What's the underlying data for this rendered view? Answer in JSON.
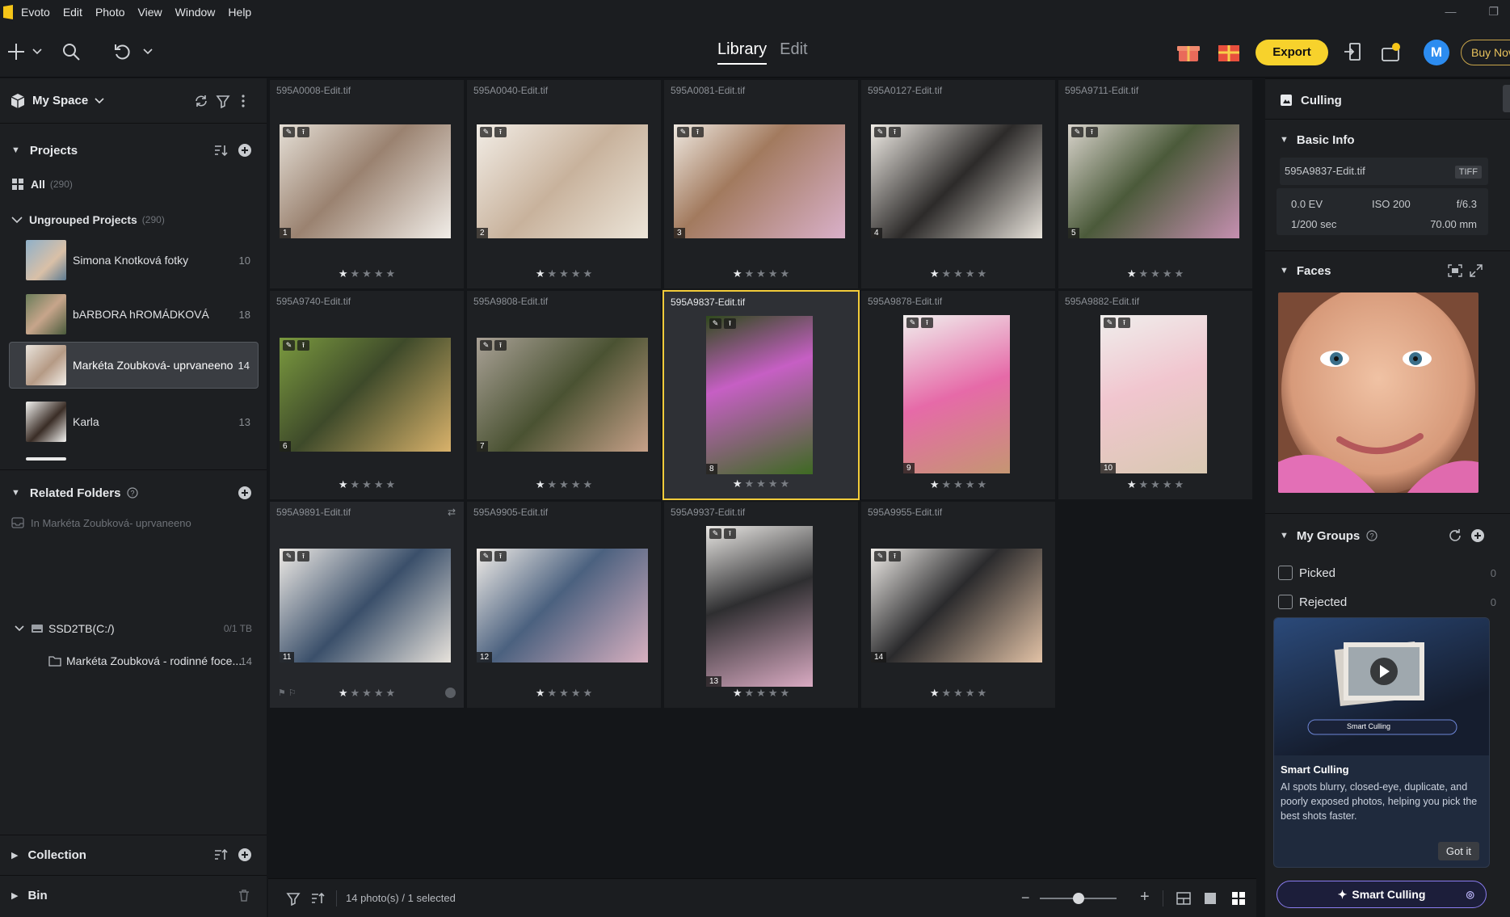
{
  "menubar": {
    "app_name": "Evoto",
    "items": [
      "Edit",
      "Photo",
      "View",
      "Window",
      "Help"
    ]
  },
  "toolbar": {
    "tab_library": "Library",
    "tab_edit": "Edit",
    "export_label": "Export",
    "avatar_initial": "M",
    "buy_label": "Buy Nov"
  },
  "left_panel": {
    "space_title": "My Space",
    "projects_title": "Projects",
    "all_label": "All",
    "all_count": "(290)",
    "ungrouped_label": "Ungrouped Projects",
    "ungrouped_count": "(290)",
    "projects": [
      {
        "name": "Simona Knotková fotky",
        "count": "10"
      },
      {
        "name": "bARBORA hROMÁDKOVÁ",
        "count": "18"
      },
      {
        "name": "Markéta Zoubková- uprvaneeno",
        "count": "14"
      },
      {
        "name": "Karla",
        "count": "13"
      }
    ],
    "related_folders_title": "Related Folders",
    "in_project_label": "In Markéta Zoubková- uprvaneeno",
    "drive_label": "SSD2TB(C:/)",
    "drive_count": "0/1 TB",
    "folder_label": "Markéta Zoubková - rodinné foce...",
    "folder_count": "14",
    "collection_title": "Collection",
    "bin_title": "Bin"
  },
  "grid": {
    "photos": [
      {
        "name": "595A0008-Edit.tif",
        "num": "1"
      },
      {
        "name": "595A0040-Edit.tif",
        "num": "2"
      },
      {
        "name": "595A0081-Edit.tif",
        "num": "3"
      },
      {
        "name": "595A0127-Edit.tif",
        "num": "4"
      },
      {
        "name": "595A9711-Edit.tif",
        "num": "5"
      },
      {
        "name": "595A9740-Edit.tif",
        "num": "6"
      },
      {
        "name": "595A9808-Edit.tif",
        "num": "7"
      },
      {
        "name": "595A9837-Edit.tif",
        "num": "8"
      },
      {
        "name": "595A9878-Edit.tif",
        "num": "9"
      },
      {
        "name": "595A9882-Edit.tif",
        "num": "10"
      },
      {
        "name": "595A9891-Edit.tif",
        "num": "11"
      },
      {
        "name": "595A9905-Edit.tif",
        "num": "12"
      },
      {
        "name": "595A9937-Edit.tif",
        "num": "13"
      },
      {
        "name": "595A9955-Edit.tif",
        "num": "14"
      }
    ],
    "rating_stars": 5,
    "rating_value": 1
  },
  "bottombar": {
    "status": "14 photo(s) / 1 selected",
    "zoom_level": 0.5
  },
  "right_panel": {
    "culling_title": "Culling",
    "basic_info_title": "Basic Info",
    "file_name": "595A9837-Edit.tif",
    "file_type": "TIFF",
    "exposure": "0.0 EV",
    "iso": "ISO 200",
    "aperture": "f/6.3",
    "shutter": "1/200 sec",
    "focal_length": "70.00 mm",
    "faces_title": "Faces",
    "groups_title": "My Groups",
    "picked_label": "Picked",
    "picked_count": "0",
    "rejected_label": "Rejected",
    "rejected_count": "0",
    "promo_pill": "Smart Culling",
    "promo_title": "Smart Culling",
    "promo_text": "AI spots blurry, closed-eye, duplicate, and poorly exposed photos, helping you pick the best shots faster.",
    "gotit_label": "Got it",
    "smart_button_label": "Smart Culling"
  },
  "colors": {
    "accent_yellow": "#f7d22c",
    "selection_border": "#f2cb3a",
    "avatar_blue": "#2c8cf0",
    "smart_purple": "#8a7cf0"
  }
}
